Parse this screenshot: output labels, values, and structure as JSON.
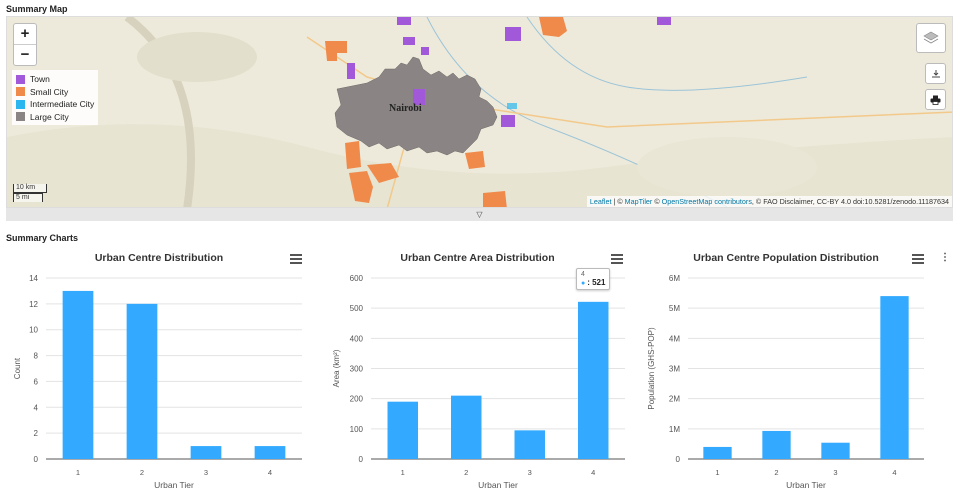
{
  "map_section": {
    "title": "Summary Map"
  },
  "charts_section": {
    "title": "Summary Charts"
  },
  "map": {
    "zoom_in_label": "+",
    "zoom_out_label": "−",
    "city_label": "Nairobi",
    "legend": [
      {
        "label": "Town",
        "color": "#a259d9"
      },
      {
        "label": "Small City",
        "color": "#f08a4b"
      },
      {
        "label": "Intermediate City",
        "color": "#2ab7f0"
      },
      {
        "label": "Large City",
        "color": "#8a8584"
      }
    ],
    "scale_km": "10 km",
    "scale_mi": "5 mi",
    "attribution_parts": [
      "Leaflet",
      " | © ",
      "MapTiler",
      " © ",
      "OpenStreetMap contributors",
      ", © FAO Disclaimer, CC-BY 4.0 doi:10.5281/zenodo.11187634"
    ],
    "layers_icon": "layers-icon",
    "download_icon": "download-icon",
    "print_icon": "print-icon",
    "collapse_icon": "▽"
  },
  "chart_data": [
    {
      "type": "bar",
      "title": "Urban Centre Distribution",
      "categories": [
        "1",
        "2",
        "3",
        "4"
      ],
      "values": [
        13,
        12,
        1,
        1
      ],
      "xlabel": "Urban Tier",
      "ylabel": "Count",
      "ylim": [
        0,
        14
      ],
      "yticks": [
        "0",
        "2",
        "4",
        "6",
        "8",
        "10",
        "12",
        "14"
      ],
      "color": "#33aaff",
      "grid": true
    },
    {
      "type": "bar",
      "title": "Urban Centre Area Distribution",
      "categories": [
        "1",
        "2",
        "3",
        "4"
      ],
      "values": [
        190,
        210,
        95,
        521
      ],
      "xlabel": "Urban Tier",
      "ylabel": "Area (km²)",
      "ylim": [
        0,
        600
      ],
      "yticks": [
        "0",
        "100",
        "200",
        "300",
        "400",
        "500",
        "600"
      ],
      "color": "#33aaff",
      "grid": true,
      "tooltip": {
        "category": "4",
        "value_text": ": 521"
      }
    },
    {
      "type": "bar",
      "title": "Urban Centre Population Distribution",
      "categories": [
        "1",
        "2",
        "3",
        "4"
      ],
      "values": [
        400000,
        930000,
        540000,
        5400000
      ],
      "xlabel": "Urban Tier",
      "ylabel": "Population (GHS-POP)",
      "ylim": [
        0,
        6000000
      ],
      "yticks": [
        "0",
        "1M",
        "2M",
        "3M",
        "4M",
        "5M",
        "6M"
      ],
      "color": "#33aaff",
      "grid": true
    }
  ]
}
